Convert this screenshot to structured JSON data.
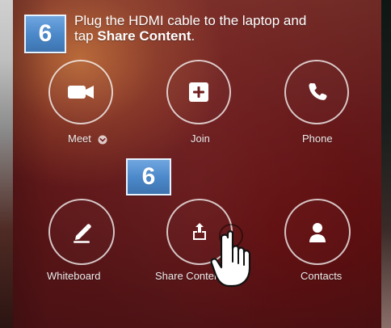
{
  "step_badges": {
    "top": "6",
    "middle": "6"
  },
  "instruction": {
    "line1": "Plug the HDMI cable to the laptop and",
    "line2_prefix": "tap ",
    "line2_bold": "Share Content",
    "line2_suffix": "."
  },
  "actions": {
    "meet": {
      "label": "Meet",
      "icon": "video-camera-icon"
    },
    "join": {
      "label": "Join",
      "icon": "plus-square-icon"
    },
    "phone": {
      "label": "Phone",
      "icon": "phone-icon"
    },
    "whiteboard": {
      "label": "Whiteboard",
      "icon": "pen-icon"
    },
    "share_content": {
      "label": "Share Content",
      "icon": "upload-tray-icon"
    },
    "contacts": {
      "label": "Contacts",
      "icon": "person-icon"
    }
  },
  "colors": {
    "badge_blue": "#4a87c9",
    "background_red": "#6f1d1e",
    "text_white": "#ffffff"
  }
}
